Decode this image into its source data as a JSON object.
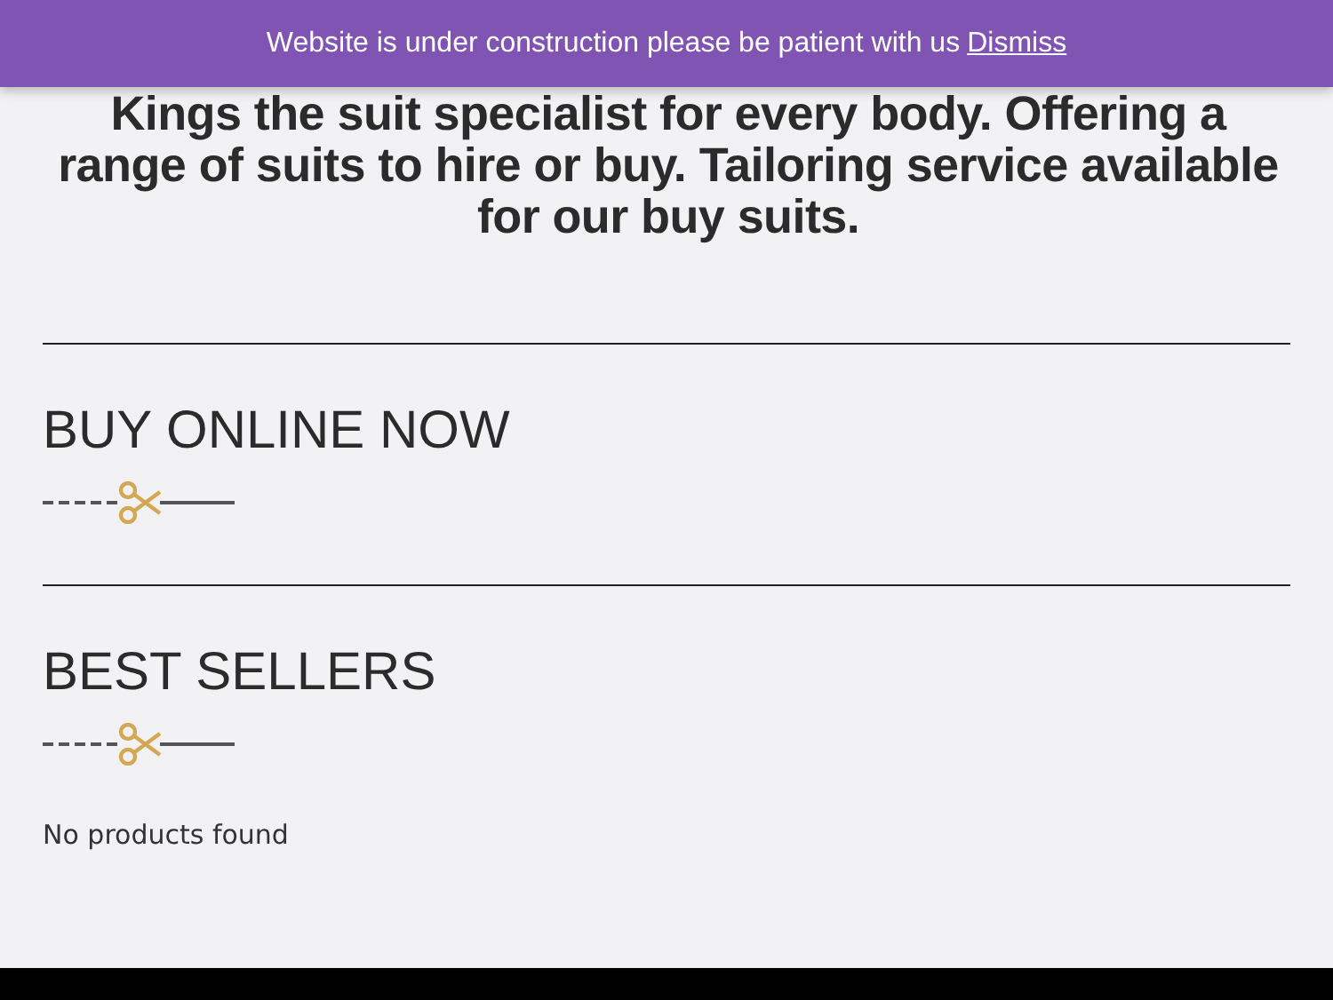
{
  "notice_bar": {
    "message": "Website is under construction please be patient with us",
    "dismiss_link": "Dismiss"
  },
  "intro": "Kings the suit specialist for every body. Offering a range of suits to hire or buy. Tailoring service available for our buy suits.",
  "sections": [
    {
      "heading": "BUY ONLINE NOW"
    },
    {
      "heading": "BEST SELLERS",
      "empty_message": "No products found"
    }
  ]
}
